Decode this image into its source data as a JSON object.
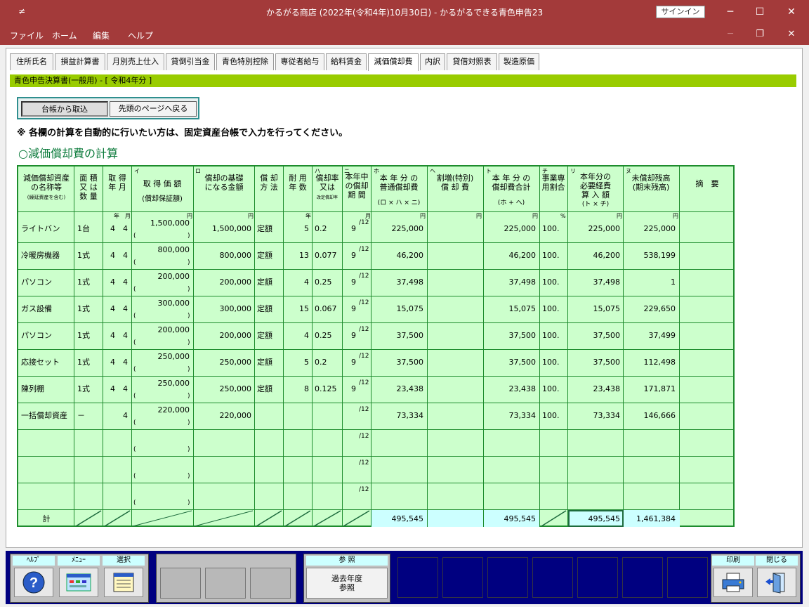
{
  "window": {
    "title": "かるがる商店 (2022年(令和4年)10月30日)  -  かるがるできる青色申告23",
    "signin": "サインイン",
    "minimize": "─",
    "maximize": "☐",
    "close": "✕"
  },
  "menu": {
    "items": [
      "ファイル",
      "ホーム",
      "編集",
      "ヘルプ"
    ],
    "min": "─",
    "restore": "❐",
    "close": "✕"
  },
  "tabs": [
    "住所氏名",
    "損益計算書",
    "月別売上仕入",
    "貸倒引当金",
    "青色特別控除",
    "専従者給与",
    "給料賃金",
    "減価償却費",
    "内訳",
    "貸借対照表",
    "製造原価"
  ],
  "active_tab": "減価償却費",
  "breadcrumb": "青色申告決算書(一般用) - [ 令和4年分 ]",
  "buttons": {
    "import": "台帳から取込",
    "back": "先頭のページへ戻る"
  },
  "notice": "※ 各欄の計算を自動的に行いたい方は、固定資産台帳で入力を行ってください。",
  "section_title": "○減価償却費の計算",
  "headers": {
    "name": "減価償却資産\nの名称等",
    "name_sub": "(繰延資産を含む)",
    "qty": "面 積\n又 は\n数 量",
    "acq_date": "取 得\n年 月",
    "acq_cost_mark": "イ",
    "acq_cost": "取 得 価 額",
    "acq_cost_sub": "(償却保証額)",
    "base_mark": "ロ",
    "base": "償却の基礎\nになる金額",
    "method": "償 却\n方 法",
    "life": "耐 用\n年 数",
    "rate_mark": "ハ",
    "rate": "償却率\n又は",
    "rate_sub": "改定償却率",
    "months_mark": "ニ",
    "months": "本年中\nの償却\n期 間",
    "normal_mark": "ホ",
    "normal": "本 年 分 の\n普通償却費",
    "normal_sub": "(ロ × ハ × ニ)",
    "special_mark": "ヘ",
    "special": "割増(特別)\n償 却 費",
    "total_mark": "ト",
    "total": "本 年 分 の\n償却費合計",
    "total_sub": "(ホ + ヘ)",
    "ratio_mark": "チ",
    "ratio": "事業専\n用割合",
    "expense_mark": "リ",
    "expense": "本年分の\n必要経費\n算 入 額",
    "expense_sub": "(ト × チ)",
    "remaining_mark": "ヌ",
    "remaining": "未償却残高\n(期末残高)",
    "summary": "摘　要"
  },
  "units": {
    "year": "年",
    "month": "月",
    "yen": "円",
    "nen": "年",
    "percent": "%",
    "per12": "/12",
    "paren_open": "(",
    "paren_close": ")"
  },
  "rows": [
    {
      "name": "ライトバン",
      "qty": "1台",
      "y": "4",
      "m": "4",
      "cost": "1,500,000",
      "base": "1,500,000",
      "method": "定額",
      "life": "5",
      "rate": "0.2",
      "months": "9",
      "normal": "225,000",
      "special": "",
      "total": "225,000",
      "ratio": "100.",
      "expense": "225,000",
      "remaining": "225,000"
    },
    {
      "name": "冷暖房機器",
      "qty": "1式",
      "y": "4",
      "m": "4",
      "cost": "800,000",
      "base": "800,000",
      "method": "定額",
      "life": "13",
      "rate": "0.077",
      "months": "9",
      "normal": "46,200",
      "special": "",
      "total": "46,200",
      "ratio": "100.",
      "expense": "46,200",
      "remaining": "538,199"
    },
    {
      "name": "パソコン",
      "qty": "1式",
      "y": "4",
      "m": "4",
      "cost": "200,000",
      "base": "200,000",
      "method": "定額",
      "life": "4",
      "rate": "0.25",
      "months": "9",
      "normal": "37,498",
      "special": "",
      "total": "37,498",
      "ratio": "100.",
      "expense": "37,498",
      "remaining": "1"
    },
    {
      "name": "ガス設備",
      "qty": "1式",
      "y": "4",
      "m": "4",
      "cost": "300,000",
      "base": "300,000",
      "method": "定額",
      "life": "15",
      "rate": "0.067",
      "months": "9",
      "normal": "15,075",
      "special": "",
      "total": "15,075",
      "ratio": "100.",
      "expense": "15,075",
      "remaining": "229,650"
    },
    {
      "name": "パソコン",
      "qty": "1式",
      "y": "4",
      "m": "4",
      "cost": "200,000",
      "base": "200,000",
      "method": "定額",
      "life": "4",
      "rate": "0.25",
      "months": "9",
      "normal": "37,500",
      "special": "",
      "total": "37,500",
      "ratio": "100.",
      "expense": "37,500",
      "remaining": "37,499"
    },
    {
      "name": "応接セット",
      "qty": "1式",
      "y": "4",
      "m": "4",
      "cost": "250,000",
      "base": "250,000",
      "method": "定額",
      "life": "5",
      "rate": "0.2",
      "months": "9",
      "normal": "37,500",
      "special": "",
      "total": "37,500",
      "ratio": "100.",
      "expense": "37,500",
      "remaining": "112,498"
    },
    {
      "name": "陳列棚",
      "qty": "1式",
      "y": "4",
      "m": "4",
      "cost": "250,000",
      "base": "250,000",
      "method": "定額",
      "life": "8",
      "rate": "0.125",
      "months": "9",
      "normal": "23,438",
      "special": "",
      "total": "23,438",
      "ratio": "100.",
      "expense": "23,438",
      "remaining": "171,871"
    },
    {
      "name": "一括償却資産",
      "qty": "－",
      "y": "",
      "m": "4",
      "cost": "220,000",
      "base": "220,000",
      "method": "",
      "life": "",
      "rate": "",
      "months": "",
      "normal": "73,334",
      "special": "",
      "total": "73,334",
      "ratio": "100.",
      "expense": "73,334",
      "remaining": "146,666"
    },
    {
      "name": "",
      "qty": "",
      "y": "",
      "m": "",
      "cost": "",
      "base": "",
      "method": "",
      "life": "",
      "rate": "",
      "months": "",
      "normal": "",
      "special": "",
      "total": "",
      "ratio": "",
      "expense": "",
      "remaining": ""
    },
    {
      "name": "",
      "qty": "",
      "y": "",
      "m": "",
      "cost": "",
      "base": "",
      "method": "",
      "life": "",
      "rate": "",
      "months": "",
      "normal": "",
      "special": "",
      "total": "",
      "ratio": "",
      "expense": "",
      "remaining": ""
    },
    {
      "name": "",
      "qty": "",
      "y": "",
      "m": "",
      "cost": "",
      "base": "",
      "method": "",
      "life": "",
      "rate": "",
      "months": "",
      "normal": "",
      "special": "",
      "total": "",
      "ratio": "",
      "expense": "",
      "remaining": ""
    }
  ],
  "totals": {
    "label": "計",
    "normal": "495,545",
    "total": "495,545",
    "expense": "495,545",
    "remaining": "1,461,384"
  },
  "footer": {
    "help_label": "ﾍﾙﾌﾟ",
    "menu_label": "ﾒﾆｭｰ",
    "select_label": "選択",
    "ref_label": "参 照",
    "ref_button": "過去年度\n参照",
    "print_label": "印刷",
    "close_label": "閉じる"
  },
  "colors": {
    "titlebar": "#a33a3a",
    "grid_bg": "#ccffcc",
    "grid_line": "#1d8c2d",
    "green_bar": "#99cc00",
    "footer_bg": "#000080"
  }
}
